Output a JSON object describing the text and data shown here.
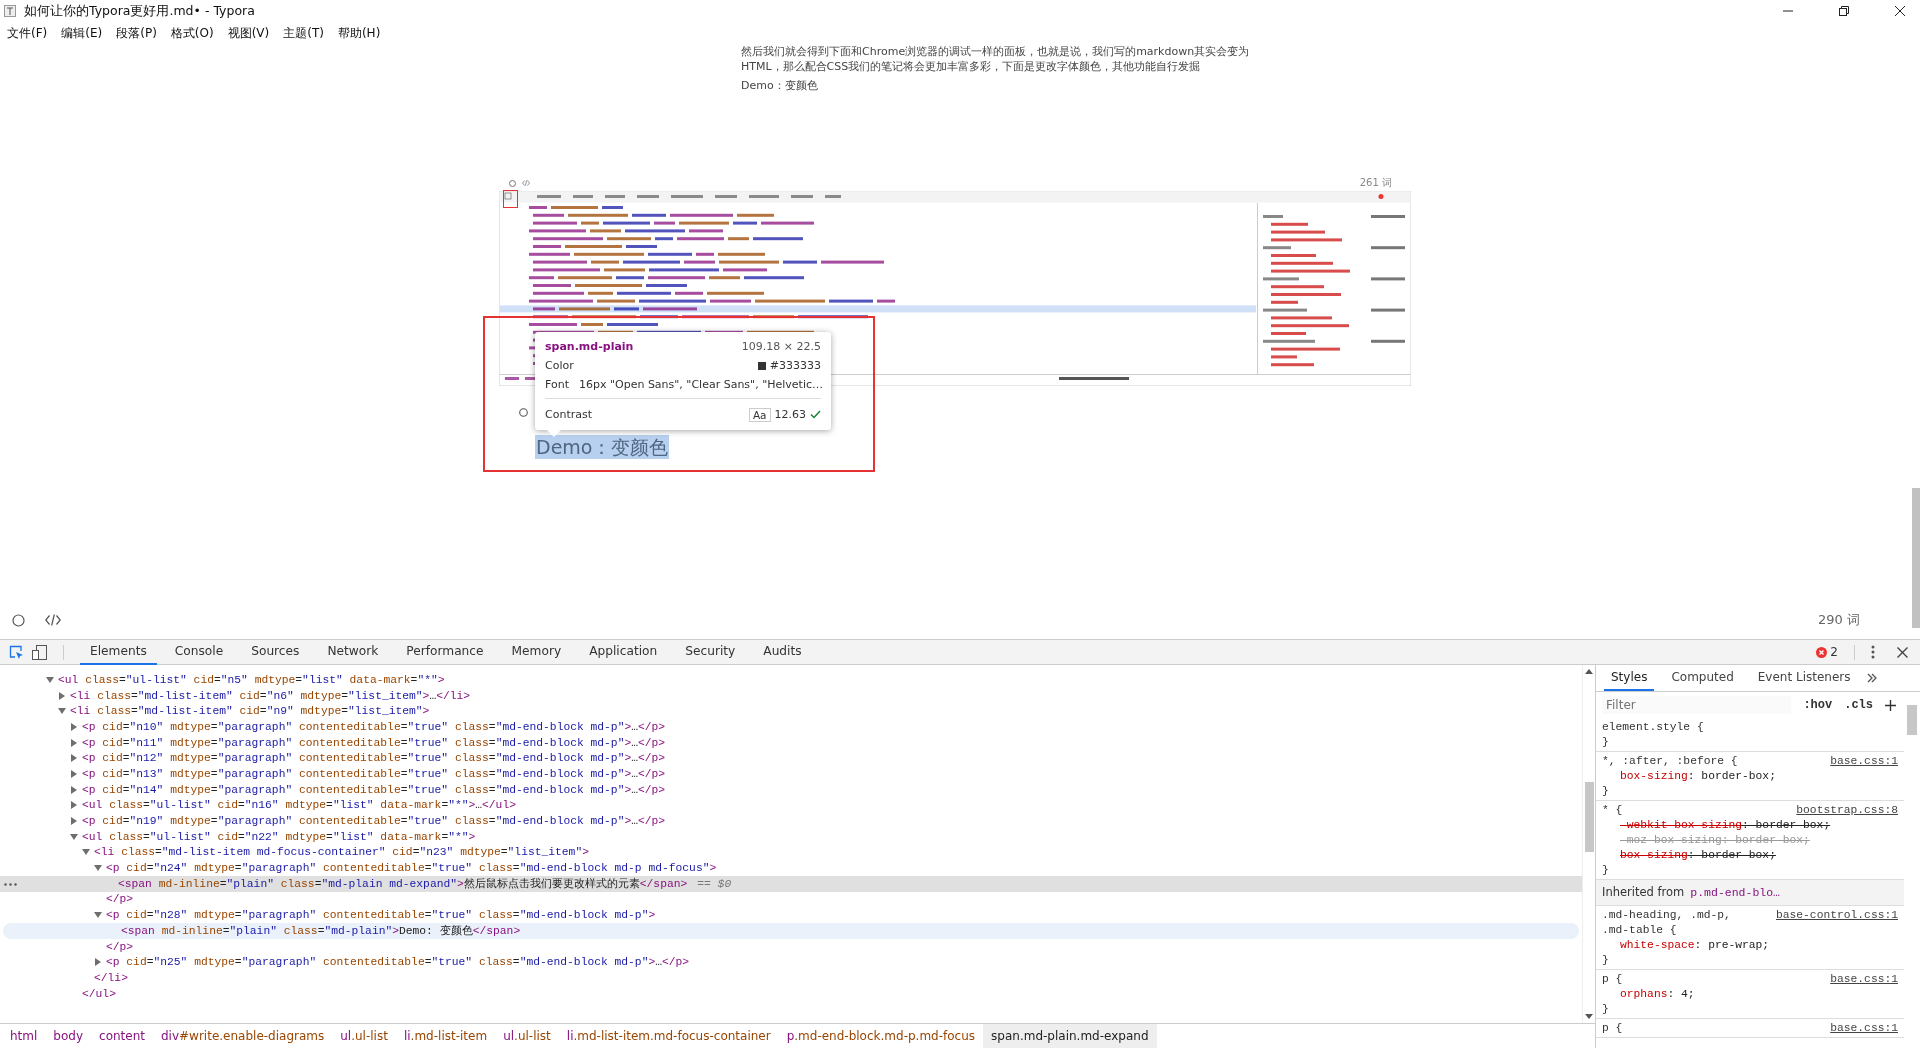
{
  "window": {
    "title": "如何让你的Typora更好用.md• - Typora"
  },
  "menu": [
    {
      "label": "文件(F)"
    },
    {
      "label": "编辑(E)"
    },
    {
      "label": "段落(P)"
    },
    {
      "label": "格式(O)"
    },
    {
      "label": "视图(V)"
    },
    {
      "label": "主题(T)"
    },
    {
      "label": "帮助(H)"
    }
  ],
  "document": {
    "paragraph": "然后我们就会得到下面和Chrome浏览器的调试一样的面板，也就是说，我们写的markdown其实会变为HTML，那么配合CSS我们的笔记将会更加丰富多彩，下面是更改字体颜色，其他功能自行发掘",
    "demo": "Demo：变颜色",
    "screenshot": {
      "word_count": "261 词",
      "tooltip": {
        "selector": "span.md-plain",
        "size": "109.18 × 22.5",
        "rows": [
          {
            "label": "Color",
            "value": "#333333",
            "color": "#333333"
          },
          {
            "label": "Font",
            "value": "16px \"Open Sans\", \"Clear Sans\", \"Helvetic…"
          }
        ],
        "contrast": {
          "label": "Contrast",
          "sample": "Aa",
          "value": "12.63",
          "pass": true
        }
      },
      "demo": "Demo：变颜色"
    }
  },
  "footer": {
    "word_count": "290 词"
  },
  "devtools": {
    "tabs": [
      {
        "label": "Elements",
        "selected": true
      },
      {
        "label": "Console",
        "selected": false
      },
      {
        "label": "Sources",
        "selected": false
      },
      {
        "label": "Network",
        "selected": false
      },
      {
        "label": "Performance",
        "selected": false
      },
      {
        "label": "Memory",
        "selected": false
      },
      {
        "label": "Application",
        "selected": false
      },
      {
        "label": "Security",
        "selected": false
      },
      {
        "label": "Audits",
        "selected": false
      }
    ],
    "error_count": "2",
    "tree": [
      {
        "markup": "<ul class=\"ul-list\" cid=\"n5\" mdtype=\"list\" data-mark=\"*\">",
        "expanded": true,
        "selected": false,
        "hovered": false,
        "children": [
          {
            "markup": "<li class=\"md-list-item\" cid=\"n6\" mdtype=\"list_item\">…</li>",
            "expanded": false,
            "selected": false,
            "hovered": false
          },
          {
            "markup": "<li class=\"md-list-item\" cid=\"n9\" mdtype=\"list_item\">",
            "expanded": true,
            "selected": false,
            "hovered": false,
            "children": [
              {
                "markup": "<p cid=\"n10\" mdtype=\"paragraph\" contenteditable=\"true\" class=\"md-end-block md-p\">…</p>",
                "expanded": false,
                "selected": false,
                "hovered": false
              },
              {
                "markup": "<p cid=\"n11\" mdtype=\"paragraph\" contenteditable=\"true\" class=\"md-end-block md-p\">…</p>",
                "expanded": false,
                "selected": false,
                "hovered": false
              },
              {
                "markup": "<p cid=\"n12\" mdtype=\"paragraph\" contenteditable=\"true\" class=\"md-end-block md-p\">…</p>",
                "expanded": false,
                "selected": false,
                "hovered": false
              },
              {
                "markup": "<p cid=\"n13\" mdtype=\"paragraph\" contenteditable=\"true\" class=\"md-end-block md-p\">…</p>",
                "expanded": false,
                "selected": false,
                "hovered": false
              },
              {
                "markup": "<p cid=\"n14\" mdtype=\"paragraph\" contenteditable=\"true\" class=\"md-end-block md-p\">…</p>",
                "expanded": false,
                "selected": false,
                "hovered": false
              },
              {
                "markup": "<ul class=\"ul-list\" cid=\"n16\" mdtype=\"list\" data-mark=\"*\">…</ul>",
                "expanded": false,
                "selected": false,
                "hovered": false
              },
              {
                "markup": "<p cid=\"n19\" mdtype=\"paragraph\" contenteditable=\"true\" class=\"md-end-block md-p\">…</p>",
                "expanded": false,
                "selected": false,
                "hovered": false
              },
              {
                "markup": "<ul class=\"ul-list\" cid=\"n22\" mdtype=\"list\" data-mark=\"*\">",
                "expanded": true,
                "selected": false,
                "hovered": false,
                "close": "</ul>",
                "children": [
                  {
                    "markup": "<li class=\"md-list-item md-focus-container\" cid=\"n23\" mdtype=\"list_item\">",
                    "expanded": true,
                    "selected": false,
                    "hovered": false,
                    "close": "</li>",
                    "children": [
                      {
                        "markup": "<p cid=\"n24\" mdtype=\"paragraph\" contenteditable=\"true\" class=\"md-end-block md-p md-focus\">",
                        "expanded": true,
                        "selected": false,
                        "hovered": false,
                        "close": "</p>",
                        "children": [
                          {
                            "markup": "<span md-inline=\"plain\" class=\"md-plain md-expand\">然后鼠标点击我们要更改样式的元素</span>",
                            "selected": true,
                            "hovered": false,
                            "suffix": "== $0"
                          }
                        ]
                      },
                      {
                        "markup": "<p cid=\"n28\" mdtype=\"paragraph\" contenteditable=\"true\" class=\"md-end-block md-p\">",
                        "expanded": true,
                        "selected": false,
                        "hovered": false,
                        "close": "</p>",
                        "children": [
                          {
                            "markup": "<span md-inline=\"plain\" class=\"md-plain\">Demo: 变颜色</span>",
                            "selected": false,
                            "hovered": true
                          }
                        ]
                      },
                      {
                        "markup": "<p cid=\"n25\" mdtype=\"paragraph\" contenteditable=\"true\" class=\"md-end-block md-p\">…</p>",
                        "expanded": false,
                        "selected": false,
                        "hovered": false
                      }
                    ]
                  }
                ]
              }
            ]
          }
        ]
      }
    ],
    "breadcrumbs": [
      {
        "label": "html",
        "selected": false
      },
      {
        "label": "body",
        "selected": false
      },
      {
        "label": "content",
        "selected": false
      },
      {
        "label": "div#write.enable-diagrams",
        "selected": false
      },
      {
        "label": "ul.ul-list",
        "selected": false
      },
      {
        "label": "li.md-list-item",
        "selected": false
      },
      {
        "label": "ul.ul-list",
        "selected": false
      },
      {
        "label": "li.md-list-item.md-focus-container",
        "selected": false
      },
      {
        "label": "p.md-end-block.md-p.md-focus",
        "selected": false
      },
      {
        "label": "span.md-plain.md-expand",
        "selected": true
      }
    ],
    "styles": {
      "tabs": [
        {
          "label": "Styles",
          "selected": true
        },
        {
          "label": "Computed",
          "selected": false
        },
        {
          "label": "Event Listeners",
          "selected": false
        }
      ],
      "filter_placeholder": "Filter",
      "hov": ":hov",
      "cls": ".cls",
      "rules": [
        {
          "kind": "rule",
          "selector": "element.style {",
          "close": "}"
        },
        {
          "kind": "rule",
          "selector": "*, :after, :before {",
          "source": "base.css:1",
          "declarations": [
            {
              "text": "box-sizing: border-box;",
              "overridden": false,
              "unsupported": false
            }
          ],
          "close": "}"
        },
        {
          "kind": "rule",
          "selector": "* {",
          "source": "bootstrap.css:8",
          "declarations": [
            {
              "text": "-webkit-box-sizing: border-box;",
              "overridden": true,
              "unsupported": false
            },
            {
              "text": "-moz-box-sizing: border-box;",
              "overridden": true,
              "unsupported": true
            },
            {
              "text": "box-sizing: border-box;",
              "overridden": true,
              "unsupported": false
            }
          ],
          "close": "}"
        },
        {
          "kind": "inherited",
          "label": "Inherited from",
          "element": "p.md-end-blo…"
        },
        {
          "kind": "rule",
          "selector": ".md-heading, .md-p, .md-table {",
          "source": "base-control.css:1",
          "declarations": [
            {
              "text": "white-space: pre-wrap;",
              "overridden": false,
              "unsupported": false
            }
          ],
          "close": "}"
        },
        {
          "kind": "rule",
          "selector": "p {",
          "source": "base.css:1",
          "declarations": [
            {
              "text": "orphans: 4;",
              "overridden": false,
              "unsupported": false
            }
          ],
          "close": "}"
        },
        {
          "kind": "rule",
          "selector": "p {",
          "source": "base.css:1"
        }
      ]
    }
  }
}
